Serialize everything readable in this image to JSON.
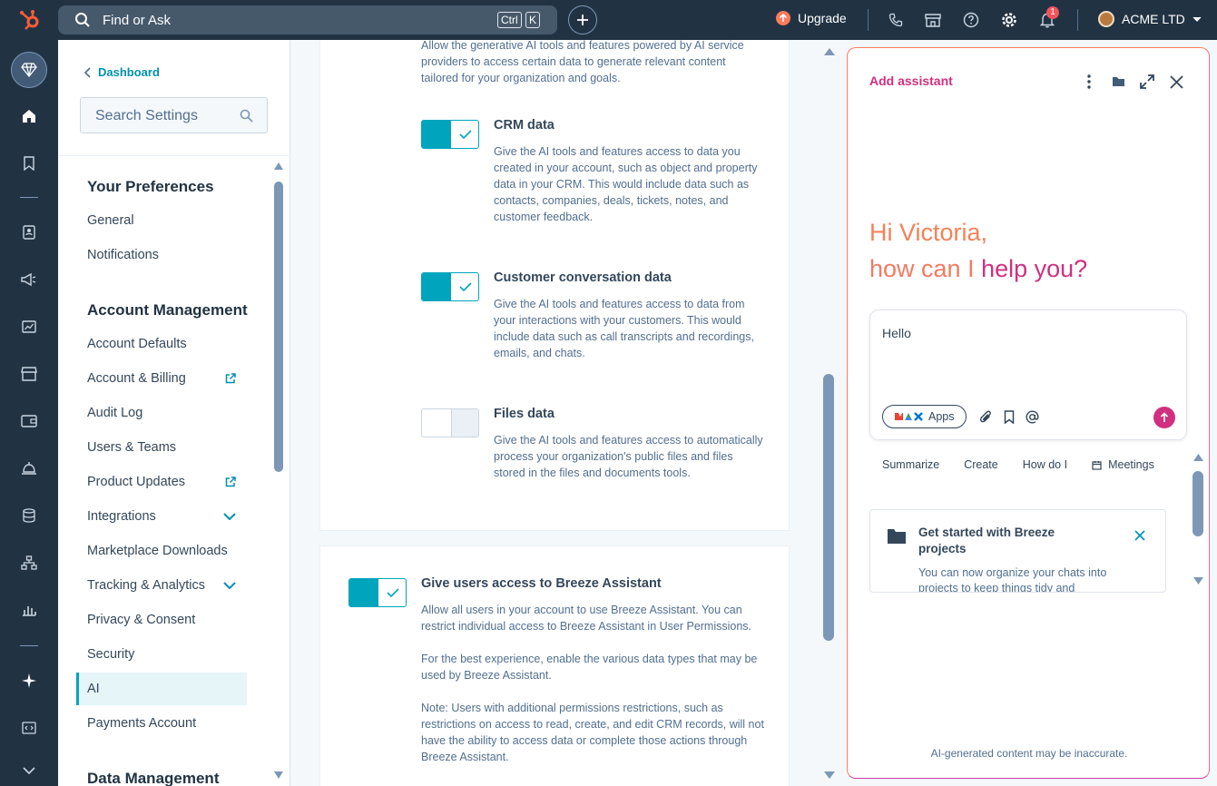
{
  "topbar": {
    "search_text": "Find or Ask",
    "shortcut_keys": [
      "Ctrl",
      "K"
    ],
    "upgrade_label": "Upgrade",
    "notification_count": "1",
    "account_name": "ACME LTD",
    "brand_color": "#ff5c35"
  },
  "sidebar": {
    "back_label": "Dashboard",
    "search_placeholder": "Search Settings",
    "sections": [
      {
        "heading": "Your Preferences",
        "items": [
          "General",
          "Notifications"
        ]
      },
      {
        "heading": "Account Management",
        "items": [
          "Account Defaults",
          "Account & Billing",
          "Audit Log",
          "Users & Teams",
          "Product Updates",
          "Integrations",
          "Marketplace Downloads",
          "Tracking & Analytics",
          "Privacy & Consent",
          "Security",
          "AI",
          "Payments Account"
        ]
      },
      {
        "heading": "Data Management",
        "items": []
      }
    ],
    "active_item": "AI",
    "external_link_items": [
      "Account & Billing",
      "Product Updates"
    ],
    "expandable_items": [
      "Integrations",
      "Tracking & Analytics"
    ]
  },
  "main": {
    "intro_text": "Allow the generative AI tools and features powered by AI service providers to access certain data to generate relevant content tailored for your organization and goals.",
    "options": [
      {
        "title": "CRM data",
        "enabled": true,
        "description": "Give the AI tools and features access to data you created in your account, such as object and property data in your CRM. This would include data such as contacts, companies, deals, tickets, notes, and customer feedback."
      },
      {
        "title": "Customer conversation data",
        "enabled": true,
        "description": "Give the AI tools and features access to data from your interactions with your customers. This would include data such as call transcripts and recordings, emails, and chats."
      },
      {
        "title": "Files data",
        "enabled": false,
        "description": "Give the AI tools and features access to automatically process your organization's public files and files stored in the files and documents tools."
      }
    ],
    "breeze_access": {
      "title": "Give users access to Breeze Assistant",
      "enabled": true,
      "paragraphs": [
        "Allow all users in your account to use Breeze Assistant. You can restrict individual access to Breeze Assistant in User Permissions.",
        "For the best experience, enable the various data types that may be used by Breeze Assistant.",
        "Note: Users with additional permissions restrictions, such as restrictions on access to read, create, and edit CRM records, will not have the ability to access data or complete those actions through Breeze Assistant."
      ]
    }
  },
  "assistant": {
    "title": "Add assistant",
    "greeting_line1": "Hi Victoria,",
    "greeting_line2_a": "how can I ",
    "greeting_line2_b": "help you?",
    "input_value": "Hello",
    "apps_label": "Apps",
    "chips": [
      "Summarize",
      "Create",
      "How do I",
      "Meetings"
    ],
    "card_title": "Get started with Breeze projects",
    "card_body": "You can now organize your chats into projects to keep things tidy and",
    "disclaimer": "AI-generated content may be inaccurate.",
    "accent_color": "#d0307f"
  }
}
